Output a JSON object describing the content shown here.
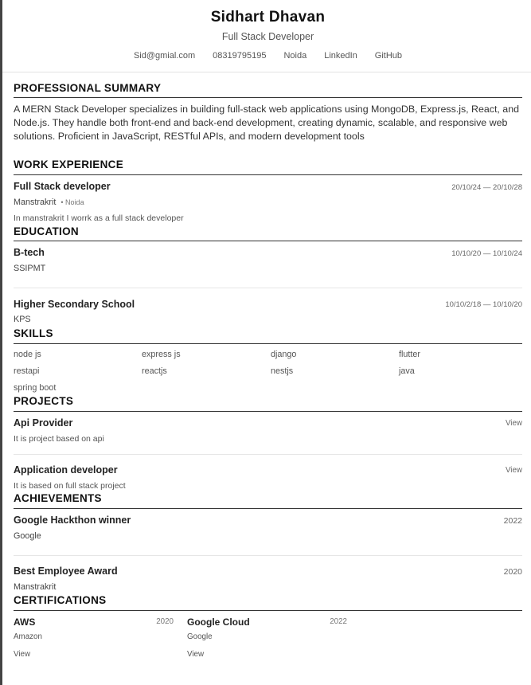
{
  "header": {
    "name": "Sidhart Dhavan",
    "role": "Full Stack Developer",
    "contacts": [
      "Sid@gmial.com",
      "08319795195",
      "Noida",
      "LinkedIn",
      "GitHub"
    ]
  },
  "summary": {
    "title": "PROFESSIONAL SUMMARY",
    "text": "A MERN Stack Developer specializes in building full-stack web applications using MongoDB, Express.js, React, and Node.js. They handle both front-end and back-end development, creating dynamic, scalable, and responsive web solutions. Proficient in JavaScript, RESTful APIs, and modern development tools"
  },
  "experience": {
    "title": "WORK EXPERIENCE",
    "items": [
      {
        "position": "Full Stack developer",
        "dates": "20/10/24 — 20/10/28",
        "company": "Manstrakrit",
        "location": "• Noida",
        "description": "In manstrakrit I worrk as a full stack developer"
      }
    ]
  },
  "education": {
    "title": "EDUCATION",
    "items": [
      {
        "degree": "B-tech",
        "dates": "10/10/20 — 10/10/24",
        "school": "SSIPMT"
      },
      {
        "degree": "Higher Secondary School",
        "dates": "10/10/2/18 — 10/10/20",
        "school": "KPS"
      }
    ]
  },
  "skills": {
    "title": "SKILLS",
    "items": [
      "node js",
      "express js",
      "django",
      "flutter",
      "restapi",
      "reactjs",
      "nestjs",
      "java",
      "spring boot"
    ]
  },
  "projects": {
    "title": "PROJECTS",
    "items": [
      {
        "name": "Api Provider",
        "link": "View",
        "description": "It is project based on api"
      },
      {
        "name": "Application developer",
        "link": "View",
        "description": "It is based on full stack project"
      }
    ]
  },
  "achievements": {
    "title": "ACHIEVEMENTS",
    "items": [
      {
        "name": "Google Hackthon winner",
        "year": "2022",
        "issuer": "Google"
      },
      {
        "name": "Best Employee Award",
        "year": "2020",
        "issuer": "Manstrakrit"
      }
    ]
  },
  "certifications": {
    "title": "CERTIFICATIONS",
    "items": [
      {
        "name": "AWS",
        "year": "2020",
        "issuer": "Amazon",
        "link": "View"
      },
      {
        "name": "Google Cloud",
        "year": "2022",
        "issuer": "Google",
        "link": "View"
      }
    ]
  }
}
